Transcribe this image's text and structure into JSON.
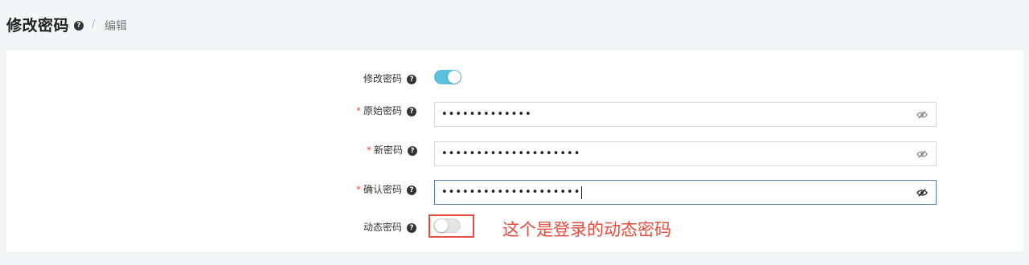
{
  "header": {
    "title": "修改密码",
    "breadcrumb_sep": "/",
    "breadcrumb": "编辑"
  },
  "form": {
    "change_password": {
      "label": "修改密码",
      "enabled": true
    },
    "original_password": {
      "required": "*",
      "label": "原始密码",
      "value": "•••••••••••••"
    },
    "new_password": {
      "required": "*",
      "label": "新密码",
      "value": "••••••••••••••••••••"
    },
    "confirm_password": {
      "required": "*",
      "label": "确认密码",
      "value": "••••••••••••••••••••"
    },
    "dynamic_password": {
      "label": "动态密码",
      "enabled": false
    }
  },
  "annotation": {
    "text": "这个是登录的动态密码",
    "color": "#e74c3c"
  },
  "icons": {
    "help": "question-circle-icon",
    "eye": "eye-slash-icon"
  },
  "colors": {
    "toggle_on": "#5bc0de",
    "required": "#e74c3c"
  }
}
